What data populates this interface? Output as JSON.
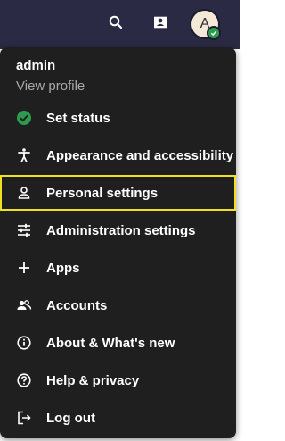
{
  "topbar": {
    "search_icon": "search-icon",
    "contacts_icon": "contacts-icon",
    "avatar_initial": "A",
    "avatar_status_color": "#2d9b4e"
  },
  "menu": {
    "user_name": "admin",
    "view_profile": "View profile",
    "items": [
      {
        "label": "Set status",
        "icon": "status-check-icon"
      },
      {
        "label": "Appearance and accessibility",
        "icon": "accessibility-icon"
      },
      {
        "label": "Personal settings",
        "icon": "person-icon"
      },
      {
        "label": "Administration settings",
        "icon": "tune-icon"
      },
      {
        "label": "Apps",
        "icon": "plus-icon"
      },
      {
        "label": "Accounts",
        "icon": "accounts-icon"
      },
      {
        "label": "About & What's new",
        "icon": "info-icon"
      },
      {
        "label": "Help & privacy",
        "icon": "help-icon"
      },
      {
        "label": "Log out",
        "icon": "logout-icon"
      }
    ],
    "highlight_color": "#f0e020"
  }
}
